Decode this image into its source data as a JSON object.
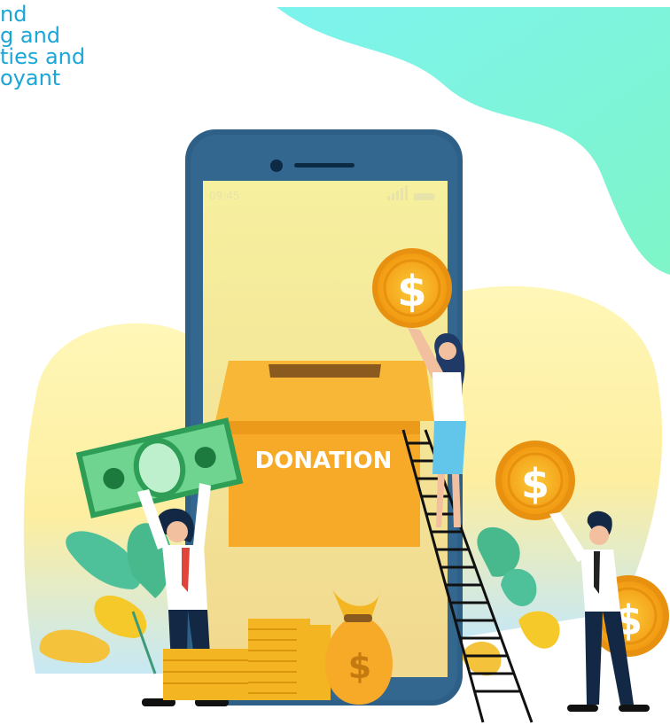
{
  "caption": {
    "lines": [
      "nd",
      "g and",
      "ties and",
      "oyant"
    ]
  },
  "phone": {
    "time": "09:45"
  },
  "donation_box": {
    "label": "DONATION"
  },
  "colors": {
    "caption_text": "#1aa6d6",
    "phone_frame": "#2e5f86",
    "phone_screen": "#f6f0a6",
    "box": "#f7a928",
    "coin": "#f4b51d",
    "banknote": "#2e9e56",
    "teal_blob": "#7ef3d6"
  }
}
